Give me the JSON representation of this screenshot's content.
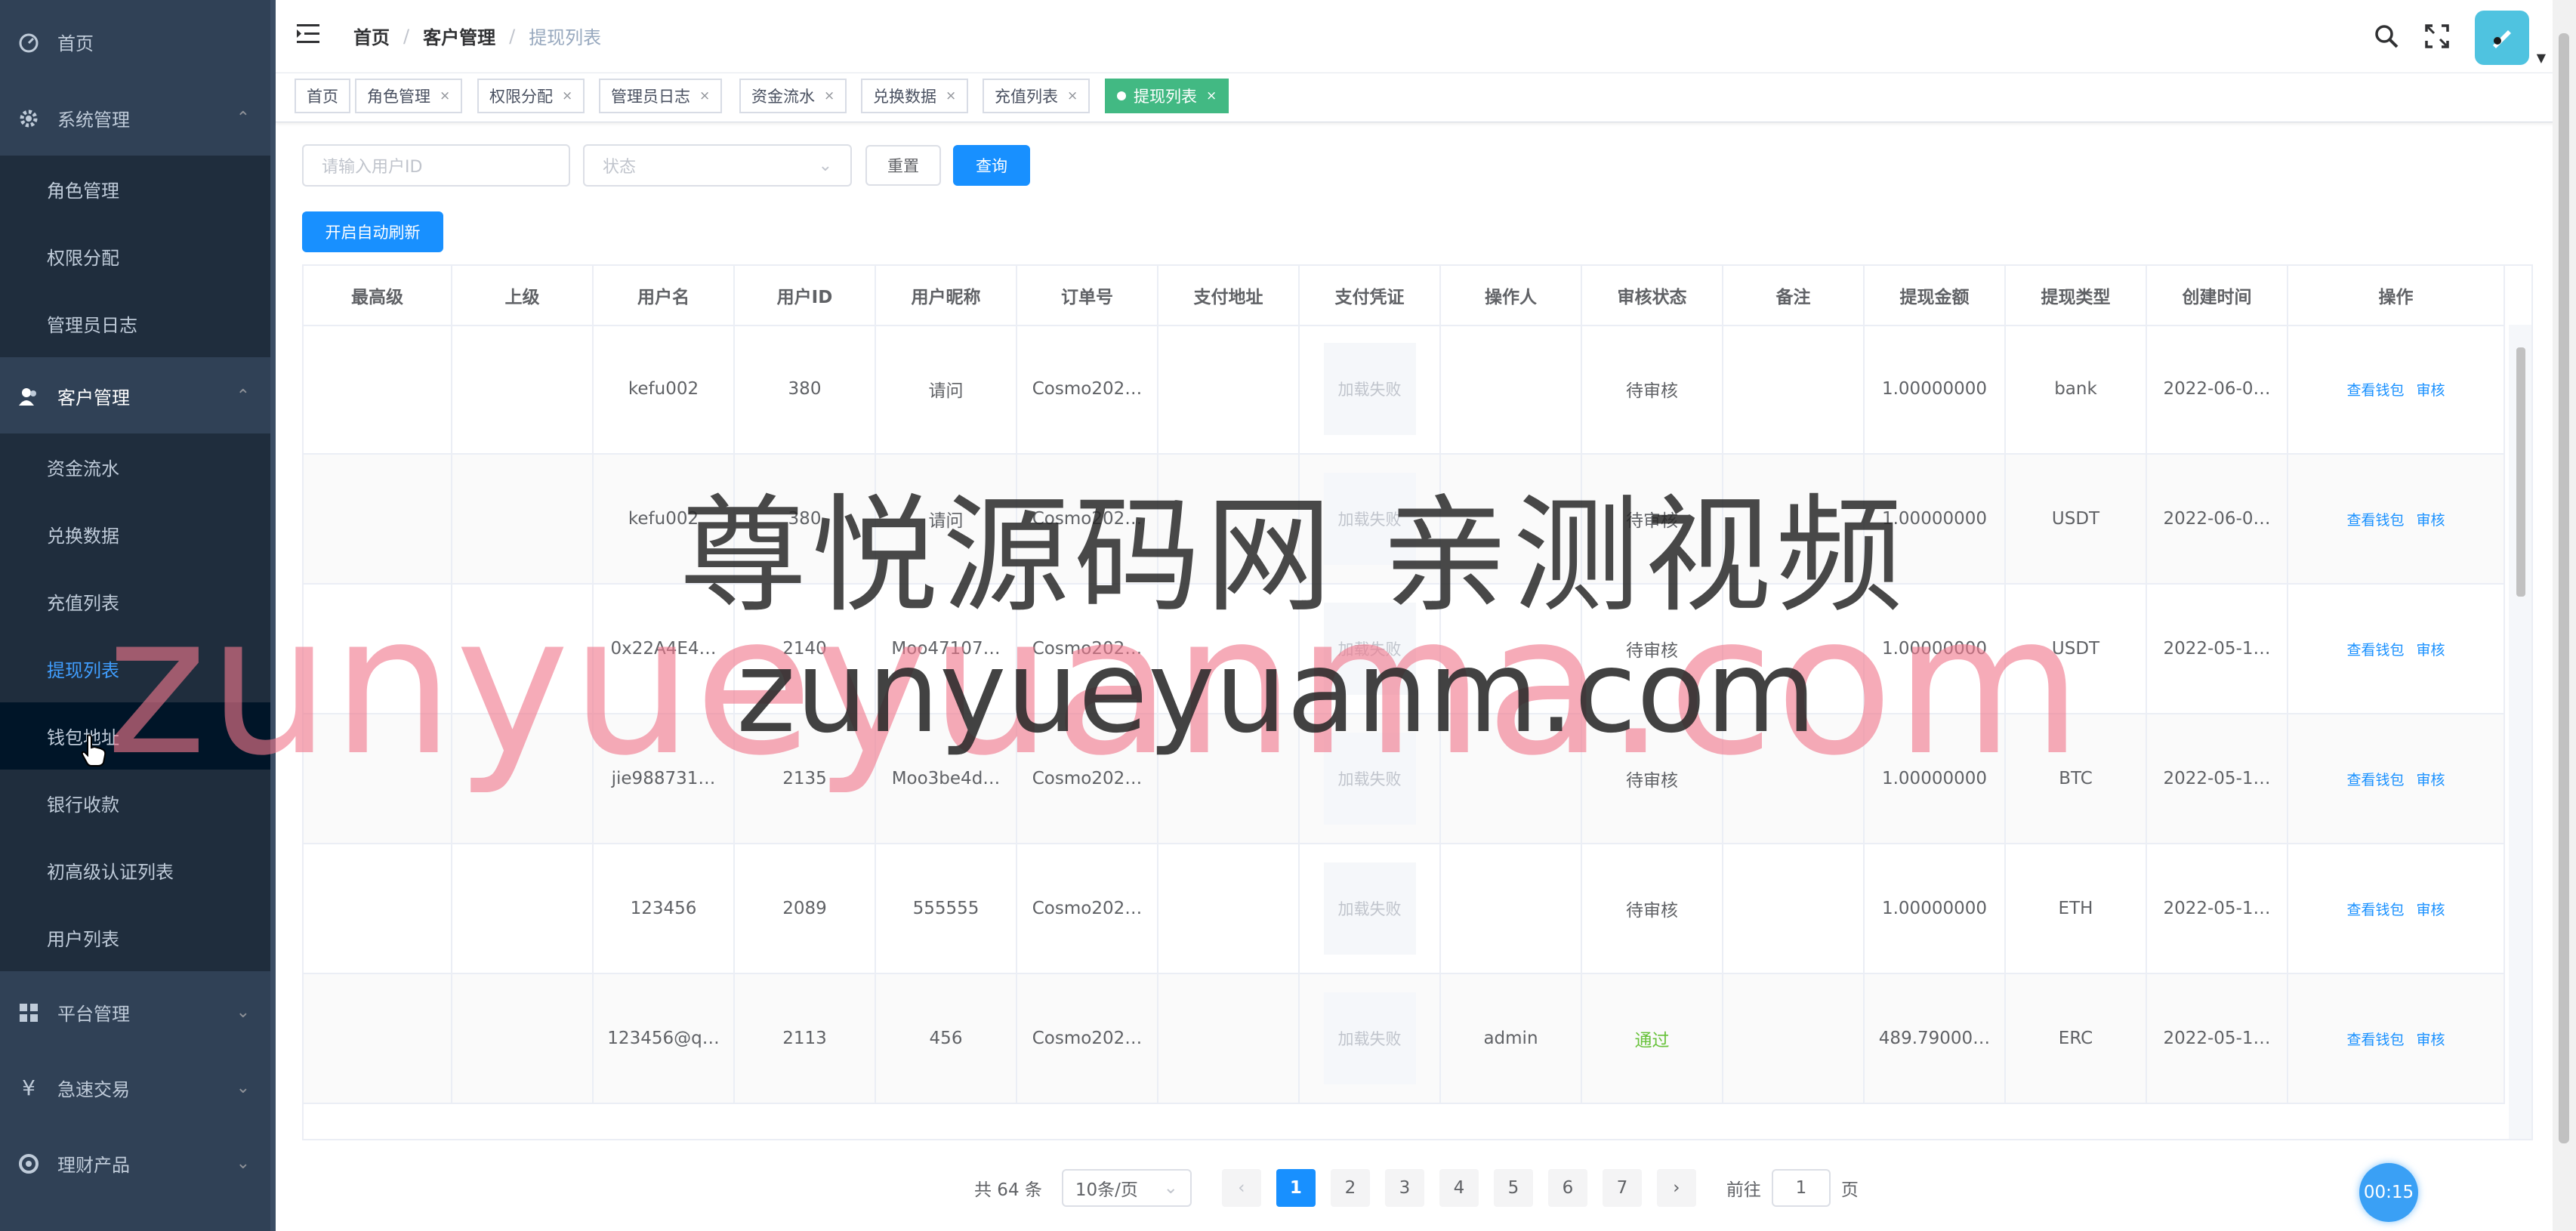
{
  "sidebar": {
    "home": "首页",
    "system": {
      "label": "系统管理",
      "items": [
        "角色管理",
        "权限分配",
        "管理员日志"
      ]
    },
    "customer": {
      "label": "客户管理",
      "items": [
        "资金流水",
        "兑换数据",
        "充值列表",
        "提现列表",
        "钱包地址",
        "银行收款",
        "初高级认证列表",
        "用户列表"
      ]
    },
    "platform": "平台管理",
    "quick_trade": "急速交易",
    "finance": "理财产品"
  },
  "breadcrumb": [
    "首页",
    "客户管理",
    "提现列表"
  ],
  "breadcrumb_sep": "/",
  "tags": [
    "首页",
    "角色管理",
    "权限分配",
    "管理员日志",
    "资金流水",
    "兑换数据",
    "充值列表",
    "提现列表"
  ],
  "tag_close": "×",
  "filters": {
    "user_id_placeholder": "请输入用户ID",
    "status_placeholder": "状态",
    "reset": "重置",
    "query": "查询",
    "auto_refresh": "开启自动刷新"
  },
  "table": {
    "columns": [
      "最高级",
      "上级",
      "用户名",
      "用户ID",
      "用户昵称",
      "订单号",
      "支付地址",
      "支付凭证",
      "操作人",
      "审核状态",
      "备注",
      "提现金额",
      "提现类型",
      "创建时间",
      "操作"
    ],
    "img_fail": "加载失败",
    "op_wallet": "查看钱包",
    "op_review": "审核",
    "rows": [
      {
        "top": "",
        "parent": "",
        "username": "kefu002",
        "uid": "380",
        "nickname": "请问",
        "order": "Cosmo202…",
        "addr": "",
        "operator": "",
        "status": "待审核",
        "remark": "",
        "amount": "1.00000000",
        "type": "bank",
        "created": "2022-06-0…"
      },
      {
        "top": "",
        "parent": "",
        "username": "kefu002",
        "uid": "380",
        "nickname": "请问",
        "order": "Cosmo202…",
        "addr": "",
        "operator": "",
        "status": "待审核",
        "remark": "",
        "amount": "1.00000000",
        "type": "USDT",
        "created": "2022-06-0…"
      },
      {
        "top": "",
        "parent": "",
        "username": "0x22A4E4…",
        "uid": "2140",
        "nickname": "Moo47107…",
        "order": "Cosmo202…",
        "addr": "",
        "operator": "",
        "status": "待审核",
        "remark": "",
        "amount": "1.00000000",
        "type": "USDT",
        "created": "2022-05-1…"
      },
      {
        "top": "",
        "parent": "",
        "username": "jie988731…",
        "uid": "2135",
        "nickname": "Moo3be4d…",
        "order": "Cosmo202…",
        "addr": "",
        "operator": "",
        "status": "待审核",
        "remark": "",
        "amount": "1.00000000",
        "type": "BTC",
        "created": "2022-05-1…"
      },
      {
        "top": "",
        "parent": "",
        "username": "123456",
        "uid": "2089",
        "nickname": "555555",
        "order": "Cosmo202…",
        "addr": "",
        "operator": "",
        "status": "待审核",
        "remark": "",
        "amount": "1.00000000",
        "type": "ETH",
        "created": "2022-05-1…"
      },
      {
        "top": "",
        "parent": "",
        "username": "123456@q…",
        "uid": "2113",
        "nickname": "456",
        "order": "Cosmo202…",
        "addr": "",
        "operator": "admin",
        "status": "通过",
        "remark": "",
        "amount": "489.79000…",
        "type": "ERC",
        "created": "2022-05-1…"
      }
    ]
  },
  "pagination": {
    "total": "共 64 条",
    "page_size": "10条/页",
    "pages": [
      "1",
      "2",
      "3",
      "4",
      "5",
      "6",
      "7"
    ],
    "current": "1",
    "goto": "前往",
    "goto_value": "1",
    "page_unit": "页"
  },
  "timer": "00:15",
  "watermark": {
    "line1": "尊悦源码网 亲测视频",
    "line2": "zunyueyuanma.com",
    "line3": "zunyueyuanm.com"
  },
  "colors": {
    "sidebar_bg": "#304156",
    "sidebar_sub_bg": "#1f2d3d",
    "primary": "#1890ff",
    "active_tag": "#42b983",
    "pass": "#67c23a"
  }
}
